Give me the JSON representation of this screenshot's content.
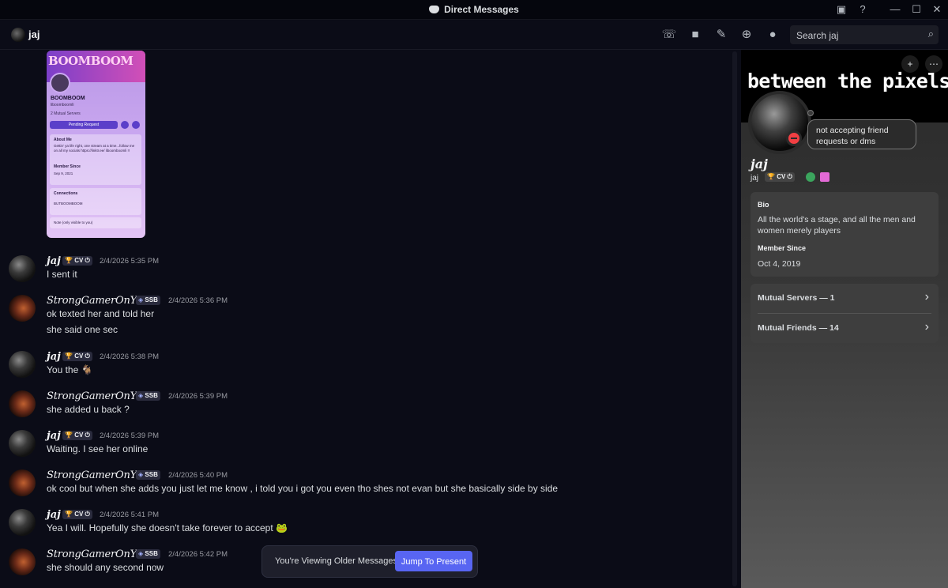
{
  "window": {
    "title": "Direct Messages"
  },
  "header": {
    "name": "jaj",
    "search_placeholder": "Search jaj"
  },
  "embed": {
    "banner_text": "BOOMBOOM",
    "name": "BOOMBOOM",
    "handle": "liboomboomli",
    "mutual": "2 Mutual Servers",
    "button": "Pending Request",
    "about_label": "About Me",
    "about_text": "Gettin' ya life right, one stream at a time...follow me on all my socials https://linktr.ee/ liboomboomli !!",
    "member_label": "Member Since",
    "member_date": "Sep 9, 2021",
    "connections_label": "Connections",
    "connection": "BUTBOOMBOOM",
    "note": "Note (only visible to you)"
  },
  "messages": [
    {
      "author": "jaj",
      "tag": "CV",
      "time": "2/4/2026 5:35 PM",
      "lines": [
        "I sent it"
      ]
    },
    {
      "author": "StrongGamerOnYT",
      "tag": "SSB",
      "time": "2/4/2026 5:36 PM",
      "lines": [
        "ok texted her and told her",
        "she said one sec"
      ]
    },
    {
      "author": "jaj",
      "tag": "CV",
      "time": "2/4/2026 5:38 PM",
      "lines": [
        "You the 🐐"
      ]
    },
    {
      "author": "StrongGamerOnYT",
      "tag": "SSB",
      "time": "2/4/2026 5:39 PM",
      "lines": [
        "she added u back ?"
      ]
    },
    {
      "author": "jaj",
      "tag": "CV",
      "time": "2/4/2026 5:39 PM",
      "lines": [
        "Waiting. I see her online"
      ]
    },
    {
      "author": "StrongGamerOnYT",
      "tag": "SSB",
      "time": "2/4/2026 5:40 PM",
      "lines": [
        "ok cool but when she adds you just let me know , i told you i got you even tho shes not evan but she basically side by side"
      ]
    },
    {
      "author": "jaj",
      "tag": "CV",
      "time": "2/4/2026 5:41 PM",
      "lines": [
        "Yea I will. Hopefully she doesn't take forever to accept 🐸"
      ]
    },
    {
      "author": "StrongGamerOnYT",
      "tag": "SSB",
      "time": "2/4/2026 5:42 PM",
      "lines": [
        "she should any second now"
      ]
    }
  ],
  "banner": {
    "text": "You're Viewing Older Messages",
    "button": "Jump To Present"
  },
  "profile": {
    "banner_title": "between the pixels",
    "status_bubble": "not accepting friend requests or dms",
    "display_name": "jaj",
    "username": "jaj",
    "tag": "CV",
    "bio_label": "Bio",
    "bio": "All the world's a stage, and all the men and women merely players",
    "member_label": "Member Since",
    "member_date": "Oct 4, 2019",
    "mutual_servers": "Mutual Servers — 1",
    "mutual_friends": "Mutual Friends — 14"
  },
  "colors": {
    "accent": "#5865f2",
    "dnd": "#f23f43",
    "background": "#0b0c17"
  }
}
